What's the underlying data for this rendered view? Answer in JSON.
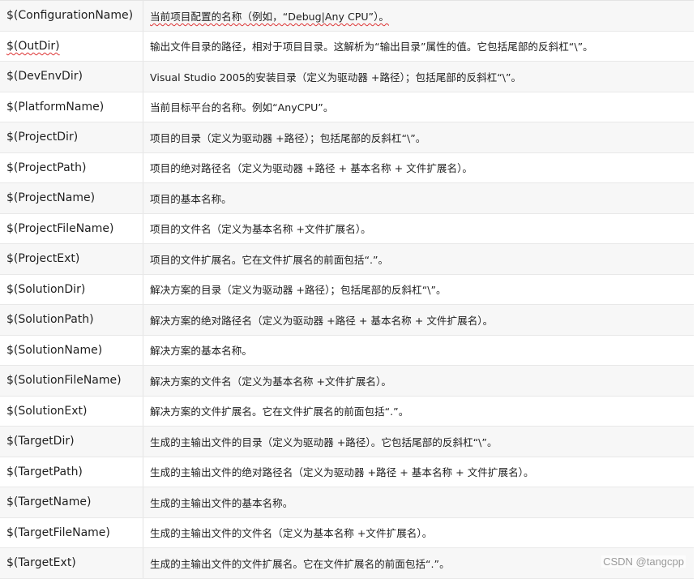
{
  "rows": [
    {
      "name": "$(ConfigurationName)",
      "desc": "当前项目配置的名称（例如，“Debug|Any CPU”）。"
    },
    {
      "name": "$(OutDir)",
      "desc": "输出文件目录的路径，相对于项目目录。这解析为“输出目录”属性的值。它包括尾部的反斜杠“\\”。"
    },
    {
      "name": "$(DevEnvDir)",
      "desc": "Visual Studio 2005的安装目录（定义为驱动器 +路径）；包括尾部的反斜杠“\\”。"
    },
    {
      "name": "$(PlatformName)",
      "desc": "当前目标平台的名称。例如“AnyCPU”。"
    },
    {
      "name": "$(ProjectDir)",
      "desc": "项目的目录（定义为驱动器 +路径）；包括尾部的反斜杠“\\”。"
    },
    {
      "name": "$(ProjectPath)",
      "desc": "项目的绝对路径名（定义为驱动器 +路径 + 基本名称 + 文件扩展名）。"
    },
    {
      "name": "$(ProjectName)",
      "desc": "项目的基本名称。"
    },
    {
      "name": "$(ProjectFileName)",
      "desc": "项目的文件名（定义为基本名称 +文件扩展名）。"
    },
    {
      "name": "$(ProjectExt)",
      "desc": "项目的文件扩展名。它在文件扩展名的前面包括“.”。"
    },
    {
      "name": "$(SolutionDir)",
      "desc": "解决方案的目录（定义为驱动器 +路径）；包括尾部的反斜杠“\\”。"
    },
    {
      "name": "$(SolutionPath)",
      "desc": "解决方案的绝对路径名（定义为驱动器 +路径 + 基本名称 + 文件扩展名）。"
    },
    {
      "name": "$(SolutionName)",
      "desc": "解决方案的基本名称。"
    },
    {
      "name": "$(SolutionFileName)",
      "desc": "解决方案的文件名（定义为基本名称 +文件扩展名）。"
    },
    {
      "name": "$(SolutionExt)",
      "desc": "解决方案的文件扩展名。它在文件扩展名的前面包括“.”。"
    },
    {
      "name": "$(TargetDir)",
      "desc": "生成的主输出文件的目录（定义为驱动器 +路径）。它包括尾部的反斜杠“\\”。"
    },
    {
      "name": "$(TargetPath)",
      "desc": "生成的主输出文件的绝对路径名（定义为驱动器 +路径 + 基本名称 + 文件扩展名）。"
    },
    {
      "name": "$(TargetName)",
      "desc": "生成的主输出文件的基本名称。"
    },
    {
      "name": "$(TargetFileName)",
      "desc": "生成的主输出文件的文件名（定义为基本名称 +文件扩展名）。"
    },
    {
      "name": "$(TargetExt)",
      "desc": "生成的主输出文件的文件扩展名。它在文件扩展名的前面包括“.”。"
    }
  ],
  "watermark": "CSDN @tangcpp"
}
